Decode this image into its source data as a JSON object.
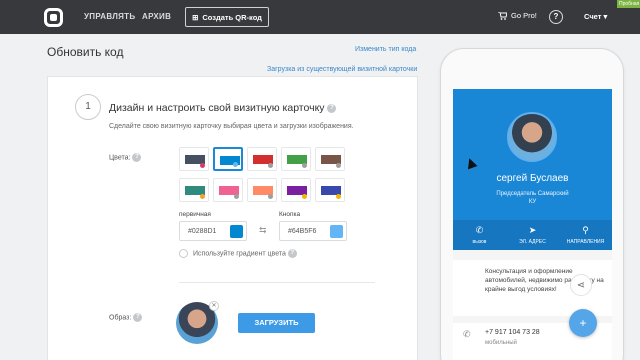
{
  "header": {
    "nav_manage": "УПРАВЛЯТЬ",
    "nav_archive": "АРХИВ",
    "create_button": "Создать QR-код",
    "cart_label": "Go Pro!",
    "help_label": "?",
    "account_label": "Счет",
    "trial_badge": "Пробная"
  },
  "page": {
    "title": "Обновить код",
    "change_type_link": "Изменить тип кода",
    "import_link": "Загрузка из существующей визитной карточки"
  },
  "step": {
    "number": "1",
    "title": "Дизайн и настроить свой визитную карточку",
    "subtitle": "Сделайте свою визитную карточку выбирая цвета и загрузки изображения.",
    "colors_label": "Цвета:",
    "swatches": [
      {
        "bar": "#455163",
        "dot": "#e0366b"
      },
      {
        "bar": "#0288d1",
        "dot": "#64b5f6",
        "selected": true
      },
      {
        "bar": "#d32f2f",
        "dot": "#9e9e9e"
      },
      {
        "bar": "#43a047",
        "dot": "#9e9e9e"
      },
      {
        "bar": "#795548",
        "dot": "#9e9e9e"
      },
      {
        "bar": "#2e8b7d",
        "dot": "#f4a325"
      },
      {
        "bar": "#f06292",
        "dot": "#9e9e9e"
      },
      {
        "bar": "#ff8a65",
        "dot": "#9e9e9e"
      },
      {
        "bar": "#7b1fa2",
        "dot": "#f4b400"
      },
      {
        "bar": "#3949ab",
        "dot": "#f4b400"
      }
    ],
    "primary_label": "первичная",
    "primary_value": "#0288D1",
    "primary_color": "#0288d1",
    "button_label": "Кнопка",
    "button_value": "#64B5F6",
    "button_color": "#64b5f6",
    "gradient_label": "Используйте градиент цвета",
    "image_label": "Образ:",
    "upload_button": "ЗАГРУЗИТЬ"
  },
  "preview": {
    "name": "сергей Буслаев",
    "position_line1": "Председатель Самарский",
    "position_line2": "КУ",
    "actions": [
      {
        "icon": "phone-icon",
        "label": "вызов"
      },
      {
        "icon": "send-icon",
        "label": "ЭЛ. АДРЕС"
      },
      {
        "icon": "location-icon",
        "label": "НАПРАВЛЕНИЯ"
      }
    ],
    "about": "Консультация и оформление автомобилей, недвижимо рассрочку на крайне выгод условиях!",
    "phone_number": "+7 917 104 73 28",
    "phone_type": "мобильный"
  }
}
